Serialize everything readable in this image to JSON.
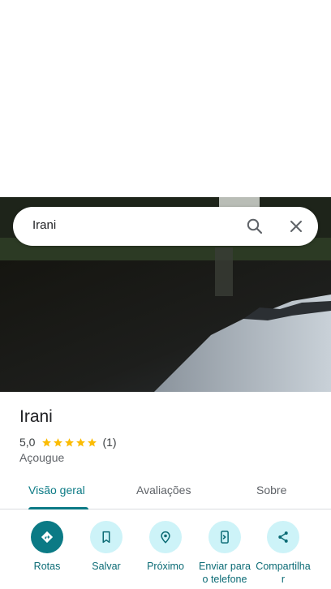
{
  "search": {
    "query": "Irani"
  },
  "place": {
    "name": "Irani",
    "rating": "5,0",
    "stars": 5,
    "review_count": "(1)",
    "category": "Açougue"
  },
  "tabs": [
    {
      "label": "Visão geral",
      "active": true
    },
    {
      "label": "Avaliações",
      "active": false
    },
    {
      "label": "Sobre",
      "active": false
    }
  ],
  "actions": [
    {
      "label": "Rotas",
      "icon": "directions-icon"
    },
    {
      "label": "Salvar",
      "icon": "bookmark-icon"
    },
    {
      "label": "Próximo",
      "icon": "nearby-icon"
    },
    {
      "label": "Enviar para o telefone",
      "icon": "send-to-phone-icon"
    },
    {
      "label": "Compartilhar",
      "icon": "share-icon"
    }
  ],
  "colors": {
    "accent": "#0b7a85",
    "action_bg": "#cdf3f8",
    "star": "#fbbc04"
  }
}
